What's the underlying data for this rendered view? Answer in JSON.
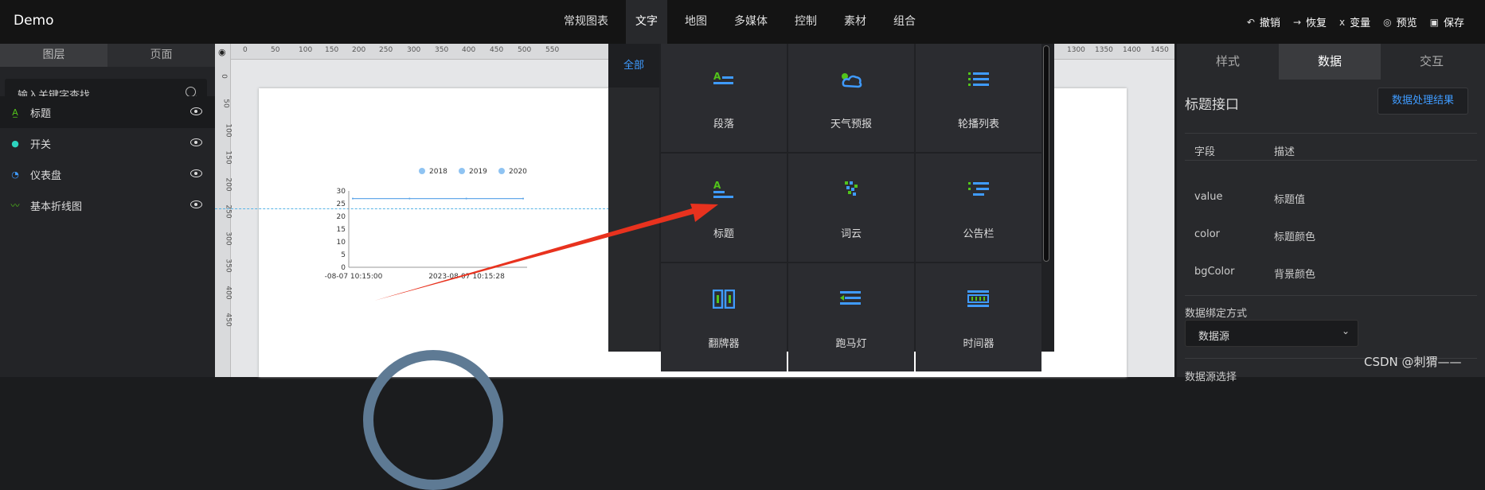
{
  "app": {
    "title": "Demo"
  },
  "nav": [
    "常规图表",
    "文字",
    "地图",
    "多媒体",
    "控制",
    "素材",
    "组合"
  ],
  "nav_active": "文字",
  "actions": [
    {
      "icon": "undo-icon",
      "glyph": "↶",
      "label": "撤销"
    },
    {
      "icon": "redo-icon",
      "glyph": "→",
      "label": "恢复"
    },
    {
      "icon": "variable-icon",
      "glyph": "x",
      "label": "变量"
    },
    {
      "icon": "preview-icon",
      "glyph": "◎",
      "label": "预览"
    },
    {
      "icon": "save-icon",
      "glyph": "▣",
      "label": "保存"
    }
  ],
  "left": {
    "tabs": [
      "图层",
      "页面"
    ],
    "search_placeholder": "输入关键字查找",
    "layers": [
      {
        "name": "标题",
        "icon": "title-icon",
        "glyph": "A̲",
        "color": "#52c41a"
      },
      {
        "name": "开关",
        "icon": "switch-icon",
        "glyph": "●",
        "color": "#2dd4bf"
      },
      {
        "name": "仪表盘",
        "icon": "gauge-icon",
        "glyph": "◔",
        "color": "#3f9bff"
      },
      {
        "name": "基本折线图",
        "icon": "line-chart-icon",
        "glyph": "〰",
        "color": "#52c41a"
      }
    ]
  },
  "ruler": {
    "top": [
      "50",
      "0",
      "50",
      "100",
      "150",
      "200",
      "250",
      "300",
      "350",
      "400",
      "450",
      "500",
      "550",
      "1300",
      "1350",
      "1400",
      "1450",
      "150"
    ],
    "left": [
      "0",
      "50",
      "100",
      "150",
      "200",
      "250",
      "300",
      "350",
      "400",
      "450"
    ]
  },
  "chart": {
    "legend": [
      "2018",
      "2019",
      "2020"
    ],
    "yticks": [
      "30",
      "25",
      "20",
      "15",
      "10",
      "5",
      "0"
    ],
    "xticks": [
      "-08-07 10:15:00",
      "2023-08-07 10:15:28"
    ]
  },
  "chart_data": {
    "type": "line",
    "categories": [
      "-08-07 10:15:00",
      "",
      "2023-08-07 10:15:28",
      ""
    ],
    "series": [
      {
        "name": "2018",
        "values": [
          27,
          27,
          27,
          27
        ]
      },
      {
        "name": "2019",
        "values": [
          27,
          27,
          27,
          27
        ]
      },
      {
        "name": "2020",
        "values": [
          27,
          27,
          27,
          27
        ]
      }
    ],
    "ylim": [
      0,
      30
    ],
    "legend_position": "top"
  },
  "panel": {
    "category": "全部",
    "items": [
      {
        "label": "段落",
        "icon": "paragraph-icon"
      },
      {
        "label": "天气预报",
        "icon": "weather-icon"
      },
      {
        "label": "轮播列表",
        "icon": "carousel-list-icon"
      },
      {
        "label": "标题",
        "icon": "title-icon"
      },
      {
        "label": "词云",
        "icon": "word-cloud-icon"
      },
      {
        "label": "公告栏",
        "icon": "notice-board-icon"
      },
      {
        "label": "翻牌器",
        "icon": "flip-counter-icon"
      },
      {
        "label": "跑马灯",
        "icon": "marquee-icon"
      },
      {
        "label": "时间器",
        "icon": "timer-icon"
      }
    ]
  },
  "right": {
    "tabs": [
      "样式",
      "数据",
      "交互"
    ],
    "active_tab": "数据",
    "interface_title": "标题接口",
    "process_button": "数据处理结果",
    "field_header": "字段",
    "desc_header": "描述",
    "fields": [
      {
        "field": "value",
        "desc": "标题值"
      },
      {
        "field": "color",
        "desc": "标题颜色"
      },
      {
        "field": "bgColor",
        "desc": "背景颜色"
      }
    ],
    "binding_label": "数据绑定方式",
    "binding_value": "数据源",
    "truncated_label": "数据源选择"
  },
  "watermark": "CSDN @刺猬——",
  "colors": {
    "accent": "#3f9bff",
    "icon_green": "#52c41a",
    "arrow": "#e8321e"
  }
}
